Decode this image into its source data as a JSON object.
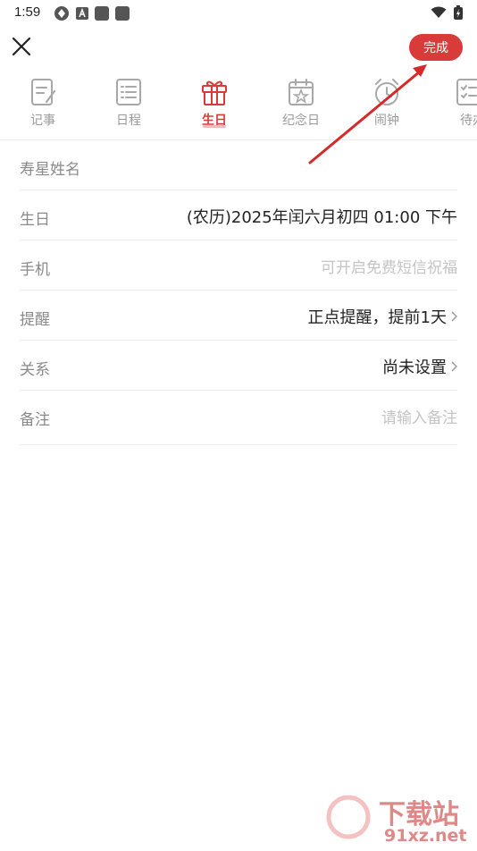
{
  "status": {
    "time": "1:59"
  },
  "header": {
    "done_label": "完成"
  },
  "tabs": [
    {
      "label": "记事",
      "icon": "note-icon",
      "active": false
    },
    {
      "label": "日程",
      "icon": "schedule-icon",
      "active": false
    },
    {
      "label": "生日",
      "icon": "gift-icon",
      "active": true
    },
    {
      "label": "纪念日",
      "icon": "calendar-star-icon",
      "active": false
    },
    {
      "label": "闹钟",
      "icon": "alarm-icon",
      "active": false
    },
    {
      "label": "待办",
      "icon": "todo-icon",
      "active": false
    }
  ],
  "form": {
    "name": {
      "label": "寿星姓名",
      "value": ""
    },
    "birthday": {
      "label": "生日",
      "value": "(农历)2025年闰六月初四 01:00 下午"
    },
    "phone": {
      "label": "手机",
      "placeholder": "可开启免费短信祝福"
    },
    "reminder": {
      "label": "提醒",
      "value": "正点提醒，提前1天"
    },
    "relation": {
      "label": "关系",
      "value": "尚未设置"
    },
    "note": {
      "label": "备注",
      "placeholder": "请输入备注"
    }
  },
  "watermark": {
    "text_cn": "下载站",
    "text_en": "91xz.net"
  },
  "colors": {
    "accent": "#d93a3a",
    "arrow": "#d62a2a",
    "muted": "#9a9a9a"
  }
}
